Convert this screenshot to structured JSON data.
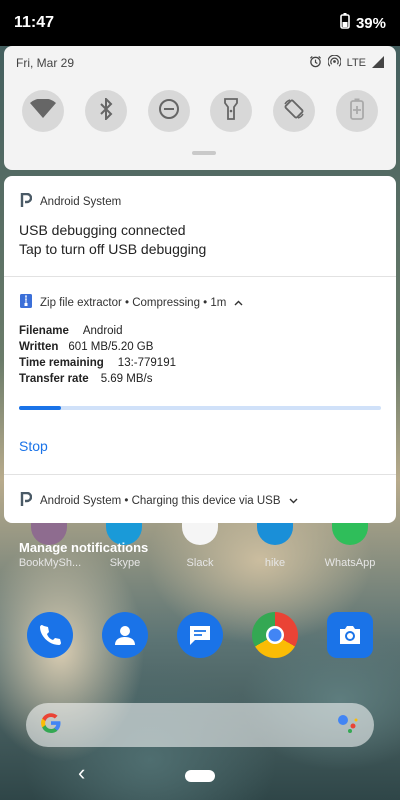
{
  "status_bar": {
    "time": "11:47",
    "battery": "39%"
  },
  "quick_settings": {
    "date": "Fri, Mar 29",
    "network": "LTE",
    "tiles": [
      {
        "name": "wifi-icon"
      },
      {
        "name": "bluetooth-icon"
      },
      {
        "name": "do-not-disturb-icon"
      },
      {
        "name": "flashlight-icon"
      },
      {
        "name": "auto-rotate-icon"
      },
      {
        "name": "battery-saver-icon"
      }
    ]
  },
  "notifications": {
    "usb_debugging": {
      "app": "Android System",
      "title": "USB debugging connected",
      "text": "Tap to turn off USB debugging"
    },
    "zip_extractor": {
      "header": "Zip file extractor • Compressing • 1m",
      "details": [
        {
          "key": "Filename",
          "value": "Android"
        },
        {
          "key": "Written",
          "value": "601 MB/5.20 GB"
        },
        {
          "key": "Time remaining",
          "value": "13:-779191"
        },
        {
          "key": "Transfer rate",
          "value": "5.69 MB/s"
        }
      ],
      "progress": 0.115,
      "action": "Stop"
    },
    "charging": {
      "header": "Android System • Charging this device via USB"
    }
  },
  "manage_notifications": "Manage notifications",
  "home": {
    "app_labels": [
      "BookMySh...",
      "Skype",
      "Slack",
      "hike",
      "WhatsApp"
    ],
    "dock_icons": [
      "phone-icon",
      "contacts-icon",
      "messages-icon",
      "chrome-icon",
      "camera-icon"
    ]
  },
  "colors": {
    "accent": "#1a73e8",
    "panel_bg": "#ffffff",
    "qs_bg": "#f3f3f3"
  }
}
